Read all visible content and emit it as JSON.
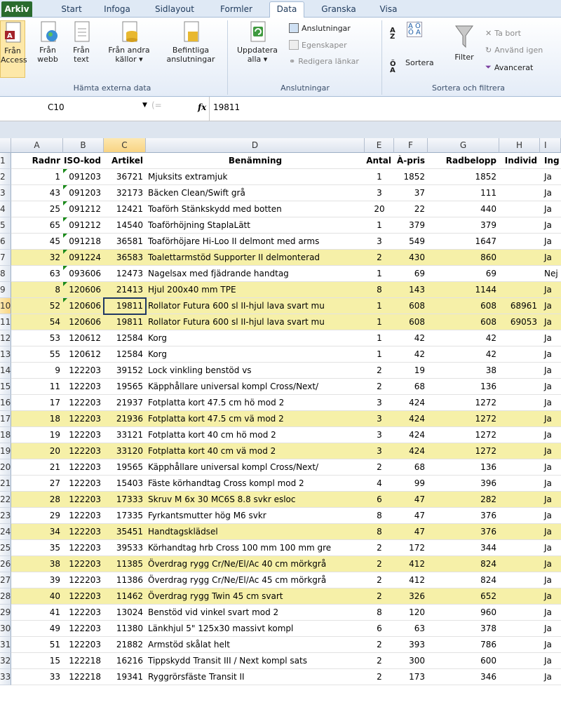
{
  "tabs": [
    "Arkiv",
    "Start",
    "Infoga",
    "Sidlayout",
    "Formler",
    "Data",
    "Granska",
    "Visa"
  ],
  "ribbon": {
    "get_external": {
      "from_access": [
        "Från",
        "Access"
      ],
      "from_web": [
        "Från",
        "webb"
      ],
      "from_text": [
        "Från",
        "text"
      ],
      "from_other": [
        "Från andra",
        "källor ▾"
      ],
      "existing": [
        "Befintliga",
        "anslutningar"
      ],
      "group_label": "Hämta externa data"
    },
    "connections": {
      "refresh": [
        "Uppdatera",
        "alla ▾"
      ],
      "connections": "Anslutningar",
      "properties": "Egenskaper",
      "edit_links": "Redigera länkar",
      "group_label": "Anslutningar"
    },
    "sort_filter": {
      "sort": "Sortera",
      "filter": "Filter",
      "clear": "Ta bort",
      "reapply": "Använd igen",
      "advanced": "Avancerat",
      "group_label": "Sortera och filtrera"
    }
  },
  "formula_bar": {
    "name_box": "C10",
    "fx": "fx",
    "value": "19811"
  },
  "columns": [
    "A",
    "B",
    "C",
    "D",
    "E",
    "F",
    "G",
    "H",
    "I"
  ],
  "headers": [
    "Radnr",
    "ISO-kod",
    "Artikel",
    "Benämning",
    "Antal",
    "À-pris",
    "Radbelopp",
    "Individ",
    "Ing"
  ],
  "rows": [
    {
      "n": "1",
      "cells": [
        "Radnr",
        "ISO-kod",
        "Artikel",
        "Benämning",
        "Antal",
        "À-pris",
        "Radbelopp",
        "Individ",
        "Ing"
      ],
      "header": true
    },
    {
      "n": "2",
      "cells": [
        "1",
        "091203",
        "36721",
        "Mjuksits extramjuk",
        "1",
        "1852",
        "1852",
        "",
        "Ja"
      ],
      "hl": false,
      "tri": true
    },
    {
      "n": "3",
      "cells": [
        "43",
        "091203",
        "32173",
        "Bäcken Clean/Swift grå",
        "3",
        "37",
        "111",
        "",
        "Ja"
      ],
      "hl": false,
      "tri": true
    },
    {
      "n": "4",
      "cells": [
        "25",
        "091212",
        "12421",
        "Toaförh Stänkskydd med botten",
        "20",
        "22",
        "440",
        "",
        "Ja"
      ],
      "hl": false,
      "tri": true
    },
    {
      "n": "5",
      "cells": [
        "65",
        "091212",
        "14540",
        "Toaförhöjning StaplaLätt",
        "1",
        "379",
        "379",
        "",
        "Ja"
      ],
      "hl": false,
      "tri": true
    },
    {
      "n": "6",
      "cells": [
        "45",
        "091218",
        "36581",
        "Toaförhöjare Hi-Loo II delmont med arms",
        "3",
        "549",
        "1647",
        "",
        "Ja"
      ],
      "hl": false,
      "tri": true
    },
    {
      "n": "7",
      "cells": [
        "32",
        "091224",
        "36583",
        "Toalettarmstöd Supporter II delmonterad",
        "2",
        "430",
        "860",
        "",
        "Ja"
      ],
      "hl": true,
      "tri": true
    },
    {
      "n": "8",
      "cells": [
        "63",
        "093606",
        "12473",
        "Nagelsax med fjädrande handtag",
        "1",
        "69",
        "69",
        "",
        "Nej"
      ],
      "hl": false,
      "tri": true
    },
    {
      "n": "9",
      "cells": [
        "8",
        "120606",
        "21413",
        "Hjul 200x40 mm TPE",
        "8",
        "143",
        "1144",
        "",
        "Ja"
      ],
      "hl": true,
      "tri": true
    },
    {
      "n": "10",
      "cells": [
        "52",
        "120606",
        "19811",
        "Rollator Futura 600 sl II-hjul lava svart mu",
        "1",
        "608",
        "608",
        "68961",
        "Ja"
      ],
      "hl": true,
      "tri": true
    },
    {
      "n": "11",
      "cells": [
        "54",
        "120606",
        "19811",
        "Rollator Futura 600 sl II-hjul lava svart mu",
        "1",
        "608",
        "608",
        "69053",
        "Ja"
      ],
      "hl": true,
      "tri": false
    },
    {
      "n": "12",
      "cells": [
        "53",
        "120612",
        "12584",
        "Korg",
        "1",
        "42",
        "42",
        "",
        "Ja"
      ],
      "hl": false,
      "tri": false
    },
    {
      "n": "13",
      "cells": [
        "55",
        "120612",
        "12584",
        "Korg",
        "1",
        "42",
        "42",
        "",
        "Ja"
      ],
      "hl": false,
      "tri": false
    },
    {
      "n": "14",
      "cells": [
        "9",
        "122203",
        "39152",
        "Lock vinkling benstöd vs",
        "2",
        "19",
        "38",
        "",
        "Ja"
      ],
      "hl": false,
      "tri": false
    },
    {
      "n": "15",
      "cells": [
        "11",
        "122203",
        "19565",
        "Käpphållare universal kompl Cross/Next/",
        "2",
        "68",
        "136",
        "",
        "Ja"
      ],
      "hl": false,
      "tri": false
    },
    {
      "n": "16",
      "cells": [
        "17",
        "122203",
        "21937",
        "Fotplatta kort 47.5 cm hö mod 2",
        "3",
        "424",
        "1272",
        "",
        "Ja"
      ],
      "hl": false,
      "tri": false
    },
    {
      "n": "17",
      "cells": [
        "18",
        "122203",
        "21936",
        "Fotplatta kort 47.5 cm vä mod 2",
        "3",
        "424",
        "1272",
        "",
        "Ja"
      ],
      "hl": true,
      "tri": false
    },
    {
      "n": "18",
      "cells": [
        "19",
        "122203",
        "33121",
        "Fotplatta kort 40 cm hö mod 2",
        "3",
        "424",
        "1272",
        "",
        "Ja"
      ],
      "hl": false,
      "tri": false
    },
    {
      "n": "19",
      "cells": [
        "20",
        "122203",
        "33120",
        "Fotplatta kort 40 cm vä mod 2",
        "3",
        "424",
        "1272",
        "",
        "Ja"
      ],
      "hl": true,
      "tri": false
    },
    {
      "n": "20",
      "cells": [
        "21",
        "122203",
        "19565",
        "Käpphållare universal kompl Cross/Next/",
        "2",
        "68",
        "136",
        "",
        "Ja"
      ],
      "hl": false,
      "tri": false
    },
    {
      "n": "21",
      "cells": [
        "27",
        "122203",
        "15403",
        "Fäste körhandtag Cross kompl mod 2",
        "4",
        "99",
        "396",
        "",
        "Ja"
      ],
      "hl": false,
      "tri": false
    },
    {
      "n": "22",
      "cells": [
        "28",
        "122203",
        "17333",
        "Skruv M 6x 30 MC6S 8.8 svkr esloc",
        "6",
        "47",
        "282",
        "",
        "Ja"
      ],
      "hl": true,
      "tri": false
    },
    {
      "n": "23",
      "cells": [
        "29",
        "122203",
        "17335",
        "Fyrkantsmutter hög M6 svkr",
        "8",
        "47",
        "376",
        "",
        "Ja"
      ],
      "hl": false,
      "tri": false
    },
    {
      "n": "24",
      "cells": [
        "34",
        "122203",
        "35451",
        "Handtagsklädsel",
        "8",
        "47",
        "376",
        "",
        "Ja"
      ],
      "hl": true,
      "tri": false
    },
    {
      "n": "25",
      "cells": [
        "35",
        "122203",
        "39533",
        "Körhandtag hrb Cross 100 mm 100 mm gre",
        "2",
        "172",
        "344",
        "",
        "Ja"
      ],
      "hl": false,
      "tri": false
    },
    {
      "n": "26",
      "cells": [
        "38",
        "122203",
        "11385",
        "Överdrag rygg Cr/Ne/El/Ac 40 cm mörkgrå",
        "2",
        "412",
        "824",
        "",
        "Ja"
      ],
      "hl": true,
      "tri": false
    },
    {
      "n": "27",
      "cells": [
        "39",
        "122203",
        "11386",
        "Överdrag rygg Cr/Ne/El/Ac 45 cm mörkgrå",
        "2",
        "412",
        "824",
        "",
        "Ja"
      ],
      "hl": false,
      "tri": false
    },
    {
      "n": "28",
      "cells": [
        "40",
        "122203",
        "11462",
        "Överdrag rygg Twin 45 cm svart",
        "2",
        "326",
        "652",
        "",
        "Ja"
      ],
      "hl": true,
      "tri": false
    },
    {
      "n": "29",
      "cells": [
        "41",
        "122203",
        "13024",
        "Benstöd vid vinkel svart mod 2",
        "8",
        "120",
        "960",
        "",
        "Ja"
      ],
      "hl": false,
      "tri": false
    },
    {
      "n": "30",
      "cells": [
        "49",
        "122203",
        "11380",
        "Länkhjul 5\" 125x30 massivt kompl",
        "6",
        "63",
        "378",
        "",
        "Ja"
      ],
      "hl": false,
      "tri": false
    },
    {
      "n": "31",
      "cells": [
        "51",
        "122203",
        "21882",
        "Armstöd skålat helt",
        "2",
        "393",
        "786",
        "",
        "Ja"
      ],
      "hl": false,
      "tri": false
    },
    {
      "n": "32",
      "cells": [
        "15",
        "122218",
        "16216",
        "Tippskydd Transit III / Next kompl sats",
        "2",
        "300",
        "600",
        "",
        "Ja"
      ],
      "hl": false,
      "tri": false
    },
    {
      "n": "33",
      "cells": [
        "33",
        "122218",
        "19341",
        "Ryggrörsfäste Transit II",
        "2",
        "173",
        "346",
        "",
        "Ja"
      ],
      "hl": false,
      "tri": false
    }
  ]
}
